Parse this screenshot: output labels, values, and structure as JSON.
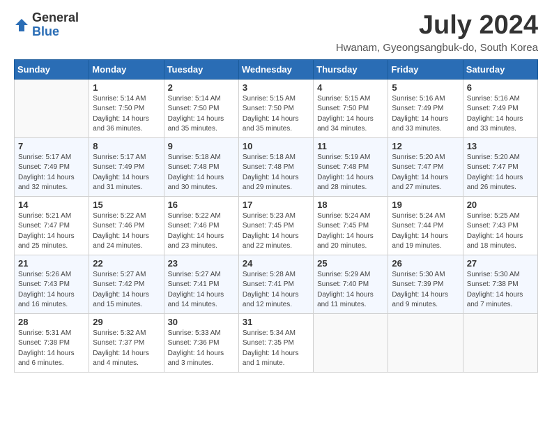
{
  "logo": {
    "general": "General",
    "blue": "Blue"
  },
  "title": "July 2024",
  "location": "Hwanam, Gyeongsangbuk-do, South Korea",
  "days_of_week": [
    "Sunday",
    "Monday",
    "Tuesday",
    "Wednesday",
    "Thursday",
    "Friday",
    "Saturday"
  ],
  "weeks": [
    [
      {
        "day": "",
        "empty": true
      },
      {
        "day": "1",
        "sunrise": "Sunrise: 5:14 AM",
        "sunset": "Sunset: 7:50 PM",
        "daylight": "Daylight: 14 hours and 36 minutes."
      },
      {
        "day": "2",
        "sunrise": "Sunrise: 5:14 AM",
        "sunset": "Sunset: 7:50 PM",
        "daylight": "Daylight: 14 hours and 35 minutes."
      },
      {
        "day": "3",
        "sunrise": "Sunrise: 5:15 AM",
        "sunset": "Sunset: 7:50 PM",
        "daylight": "Daylight: 14 hours and 35 minutes."
      },
      {
        "day": "4",
        "sunrise": "Sunrise: 5:15 AM",
        "sunset": "Sunset: 7:50 PM",
        "daylight": "Daylight: 14 hours and 34 minutes."
      },
      {
        "day": "5",
        "sunrise": "Sunrise: 5:16 AM",
        "sunset": "Sunset: 7:49 PM",
        "daylight": "Daylight: 14 hours and 33 minutes."
      },
      {
        "day": "6",
        "sunrise": "Sunrise: 5:16 AM",
        "sunset": "Sunset: 7:49 PM",
        "daylight": "Daylight: 14 hours and 33 minutes."
      }
    ],
    [
      {
        "day": "7",
        "sunrise": "Sunrise: 5:17 AM",
        "sunset": "Sunset: 7:49 PM",
        "daylight": "Daylight: 14 hours and 32 minutes."
      },
      {
        "day": "8",
        "sunrise": "Sunrise: 5:17 AM",
        "sunset": "Sunset: 7:49 PM",
        "daylight": "Daylight: 14 hours and 31 minutes."
      },
      {
        "day": "9",
        "sunrise": "Sunrise: 5:18 AM",
        "sunset": "Sunset: 7:48 PM",
        "daylight": "Daylight: 14 hours and 30 minutes."
      },
      {
        "day": "10",
        "sunrise": "Sunrise: 5:18 AM",
        "sunset": "Sunset: 7:48 PM",
        "daylight": "Daylight: 14 hours and 29 minutes."
      },
      {
        "day": "11",
        "sunrise": "Sunrise: 5:19 AM",
        "sunset": "Sunset: 7:48 PM",
        "daylight": "Daylight: 14 hours and 28 minutes."
      },
      {
        "day": "12",
        "sunrise": "Sunrise: 5:20 AM",
        "sunset": "Sunset: 7:47 PM",
        "daylight": "Daylight: 14 hours and 27 minutes."
      },
      {
        "day": "13",
        "sunrise": "Sunrise: 5:20 AM",
        "sunset": "Sunset: 7:47 PM",
        "daylight": "Daylight: 14 hours and 26 minutes."
      }
    ],
    [
      {
        "day": "14",
        "sunrise": "Sunrise: 5:21 AM",
        "sunset": "Sunset: 7:47 PM",
        "daylight": "Daylight: 14 hours and 25 minutes."
      },
      {
        "day": "15",
        "sunrise": "Sunrise: 5:22 AM",
        "sunset": "Sunset: 7:46 PM",
        "daylight": "Daylight: 14 hours and 24 minutes."
      },
      {
        "day": "16",
        "sunrise": "Sunrise: 5:22 AM",
        "sunset": "Sunset: 7:46 PM",
        "daylight": "Daylight: 14 hours and 23 minutes."
      },
      {
        "day": "17",
        "sunrise": "Sunrise: 5:23 AM",
        "sunset": "Sunset: 7:45 PM",
        "daylight": "Daylight: 14 hours and 22 minutes."
      },
      {
        "day": "18",
        "sunrise": "Sunrise: 5:24 AM",
        "sunset": "Sunset: 7:45 PM",
        "daylight": "Daylight: 14 hours and 20 minutes."
      },
      {
        "day": "19",
        "sunrise": "Sunrise: 5:24 AM",
        "sunset": "Sunset: 7:44 PM",
        "daylight": "Daylight: 14 hours and 19 minutes."
      },
      {
        "day": "20",
        "sunrise": "Sunrise: 5:25 AM",
        "sunset": "Sunset: 7:43 PM",
        "daylight": "Daylight: 14 hours and 18 minutes."
      }
    ],
    [
      {
        "day": "21",
        "sunrise": "Sunrise: 5:26 AM",
        "sunset": "Sunset: 7:43 PM",
        "daylight": "Daylight: 14 hours and 16 minutes."
      },
      {
        "day": "22",
        "sunrise": "Sunrise: 5:27 AM",
        "sunset": "Sunset: 7:42 PM",
        "daylight": "Daylight: 14 hours and 15 minutes."
      },
      {
        "day": "23",
        "sunrise": "Sunrise: 5:27 AM",
        "sunset": "Sunset: 7:41 PM",
        "daylight": "Daylight: 14 hours and 14 minutes."
      },
      {
        "day": "24",
        "sunrise": "Sunrise: 5:28 AM",
        "sunset": "Sunset: 7:41 PM",
        "daylight": "Daylight: 14 hours and 12 minutes."
      },
      {
        "day": "25",
        "sunrise": "Sunrise: 5:29 AM",
        "sunset": "Sunset: 7:40 PM",
        "daylight": "Daylight: 14 hours and 11 minutes."
      },
      {
        "day": "26",
        "sunrise": "Sunrise: 5:30 AM",
        "sunset": "Sunset: 7:39 PM",
        "daylight": "Daylight: 14 hours and 9 minutes."
      },
      {
        "day": "27",
        "sunrise": "Sunrise: 5:30 AM",
        "sunset": "Sunset: 7:38 PM",
        "daylight": "Daylight: 14 hours and 7 minutes."
      }
    ],
    [
      {
        "day": "28",
        "sunrise": "Sunrise: 5:31 AM",
        "sunset": "Sunset: 7:38 PM",
        "daylight": "Daylight: 14 hours and 6 minutes."
      },
      {
        "day": "29",
        "sunrise": "Sunrise: 5:32 AM",
        "sunset": "Sunset: 7:37 PM",
        "daylight": "Daylight: 14 hours and 4 minutes."
      },
      {
        "day": "30",
        "sunrise": "Sunrise: 5:33 AM",
        "sunset": "Sunset: 7:36 PM",
        "daylight": "Daylight: 14 hours and 3 minutes."
      },
      {
        "day": "31",
        "sunrise": "Sunrise: 5:34 AM",
        "sunset": "Sunset: 7:35 PM",
        "daylight": "Daylight: 14 hours and 1 minute."
      },
      {
        "day": "",
        "empty": true
      },
      {
        "day": "",
        "empty": true
      },
      {
        "day": "",
        "empty": true
      }
    ]
  ]
}
